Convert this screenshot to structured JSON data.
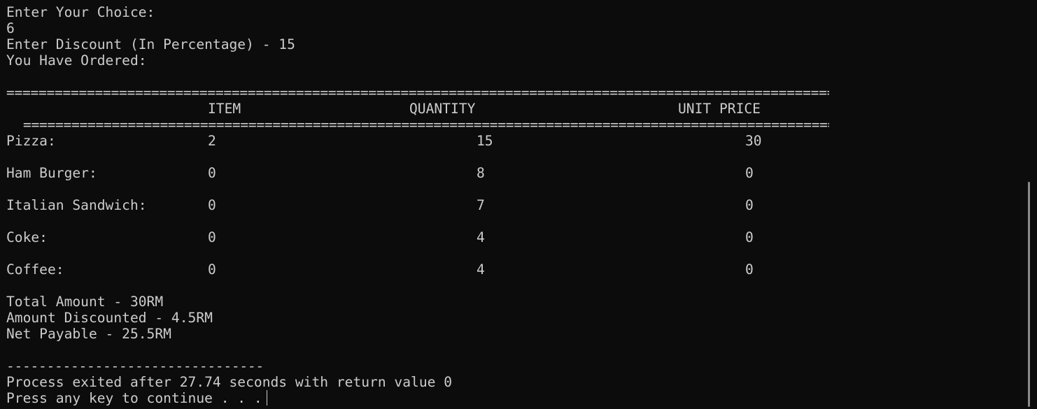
{
  "terminal": {
    "prompt_choice": "Enter Your Choice:",
    "choice_value": "6",
    "discount_line": "Enter Discount (In Percentage) - 15",
    "ordered_line": "You Have Ordered:",
    "rule_top": "=======================================================================================================================",
    "rule_mid": "=====================================================================================================================",
    "headers": {
      "item": "ITEM",
      "quantity": "QUANTITY",
      "unit_price": "UNIT PRICE"
    },
    "rows": [
      {
        "name": "Pizza:",
        "col1": "2",
        "col2": "15",
        "col3": "30"
      },
      {
        "name": "Ham Burger:",
        "col1": "0",
        "col2": "8",
        "col3": "0"
      },
      {
        "name": "Italian Sandwich:",
        "col1": "0",
        "col2": "7",
        "col3": "0"
      },
      {
        "name": "Coke:",
        "col1": "0",
        "col2": "4",
        "col3": "0"
      },
      {
        "name": "Coffee:",
        "col1": "0",
        "col2": "4",
        "col3": "0"
      }
    ],
    "total_amount": "Total Amount - 30RM",
    "amount_discounted": "Amount Discounted - 4.5RM",
    "net_payable": "Net Payable - 25.5RM",
    "dash_rule": "--------------------------------",
    "process_exit": "Process exited after 27.74 seconds with return value 0",
    "press_key": "Press any key to continue . . ."
  }
}
